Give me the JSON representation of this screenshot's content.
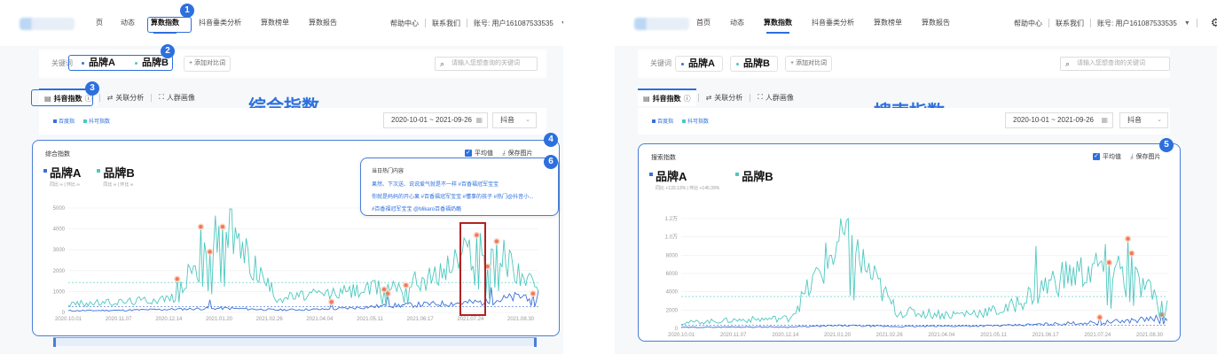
{
  "nav": {
    "items": [
      "首页",
      "动态",
      "算数指数",
      "抖音垂类分析",
      "算数榜单",
      "算数报告"
    ],
    "items_left_truncated": [
      "页",
      "动态",
      "算数指数",
      "抖音垂类分析",
      "算数榜单",
      "算数报告"
    ],
    "active": "算数指数",
    "help": "帮助中心",
    "contact": "联系我们",
    "account": "账号: 用户161087533535"
  },
  "keywords": {
    "label": "关键词",
    "brands": [
      "品牌A",
      "品牌B"
    ],
    "add": "+ 添加对比词",
    "search_placeholder": "请输入您想查询的关键词"
  },
  "tabs": [
    "抖音指数",
    "关联分析",
    "人群画像"
  ],
  "titles": {
    "left": "综合指数",
    "right": "搜索指数"
  },
  "filter": {
    "legend": [
      "百度指",
      "抖可指数"
    ],
    "date_range": "2020-10-01 ~ 2021-09-26",
    "platform": "抖音"
  },
  "left_chart": {
    "title": "综合指数",
    "brand_sub": "同比 ∞ | 环比 ∞",
    "avg_label": "平均值",
    "save_label": "保存图片",
    "hot": {
      "title": "当日热门内容",
      "lines": [
        "果然、下次送、说说爱气就是不一样 #百香福冠军宝宝",
        "你就是妈妈的开心果 #百香福冠军宝宝 #懂事的孩子 #热门@抖音小...",
        "#百香福冠军宝宝 @Mikaro百香福奶酪"
      ]
    }
  },
  "right_chart": {
    "title": "搜索指数",
    "brand_sub": "同比 +133.13% | 环比 +145.39%",
    "avg_label": "平均值",
    "save_label": "保存图片"
  },
  "badges": [
    "1",
    "2",
    "3",
    "4",
    "5",
    "6"
  ],
  "colors": {
    "accent": "#2d6fde",
    "teal": "#4ec8c0",
    "blue": "#3b6fd6",
    "peak": "#f07a5a",
    "red": "#b22222"
  },
  "chart_data": [
    {
      "type": "line",
      "title": "综合指数",
      "x": [
        "2020.10.01",
        "2020.11.07",
        "2020.12.14",
        "2021.01.20",
        "2021.02.26",
        "2021.04.04",
        "2021.05.11",
        "2021.06.17",
        "2021.07.24",
        "2021.08.30"
      ],
      "ylim": [
        0,
        5000
      ],
      "yticks": [
        0,
        1000,
        2000,
        3000,
        4000,
        5000
      ],
      "series": [
        {
          "name": "品牌A",
          "color": "#3b6fd6",
          "values": [
            80,
            100,
            150,
            200,
            120,
            150,
            300,
            400,
            500,
            900
          ]
        },
        {
          "name": "品牌B",
          "color": "#4ec8c0",
          "values": [
            400,
            500,
            700,
            4200,
            700,
            900,
            1200,
            1700,
            3600,
            1000
          ]
        }
      ],
      "average_line": true
    },
    {
      "type": "line",
      "title": "搜索指数",
      "x": [
        "2020.10.01",
        "2020.11.07",
        "2020.12.14",
        "2021.01.20",
        "2021.02.26",
        "2021.04.04",
        "2021.05.11",
        "2021.06.17",
        "2021.07.24",
        "2021.08.30"
      ],
      "ytick_labels": [
        "0",
        "2000",
        "4000",
        "6000",
        "8000",
        "1.0万",
        "1.2万"
      ],
      "ylim": [
        0,
        12000
      ],
      "series": [
        {
          "name": "品牌A",
          "color": "#3b6fd6",
          "values": [
            100,
            150,
            150,
            300,
            200,
            250,
            300,
            500,
            700,
            1200
          ]
        },
        {
          "name": "品牌B",
          "color": "#4ec8c0",
          "values": [
            600,
            900,
            1100,
            10000,
            1800,
            1500,
            2000,
            5500,
            7000,
            2500
          ]
        }
      ],
      "average_line": true
    }
  ]
}
